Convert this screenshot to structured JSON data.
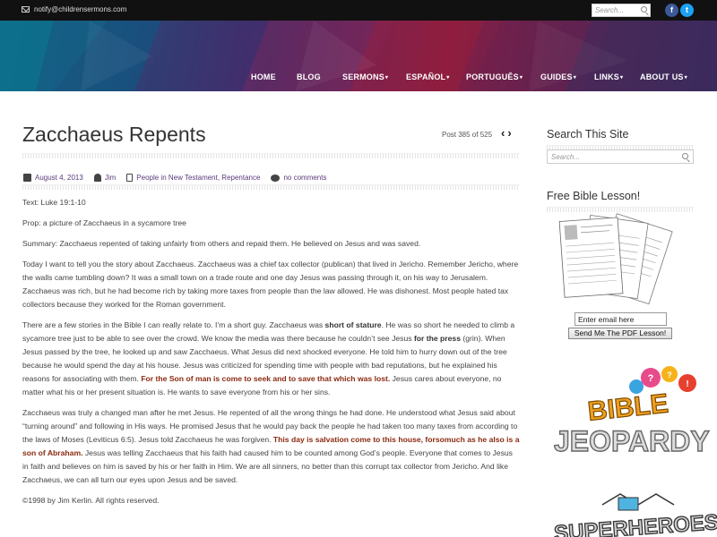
{
  "topbar": {
    "email": "notify@childrensermons.com",
    "search_placeholder": "Search...",
    "facebook": "f",
    "twitter": "t"
  },
  "nav": {
    "items": [
      {
        "label": "HOME",
        "dropdown": false
      },
      {
        "label": "BLOG",
        "dropdown": false
      },
      {
        "label": "SERMONS",
        "dropdown": true
      },
      {
        "label": "ESPAÑOL",
        "dropdown": true
      },
      {
        "label": "PORTUGUÊS",
        "dropdown": true
      },
      {
        "label": "GUIDES",
        "dropdown": true
      },
      {
        "label": "LINKS",
        "dropdown": true
      },
      {
        "label": "ABOUT US",
        "dropdown": true
      }
    ],
    "caret": "▾"
  },
  "post": {
    "title": "Zacchaeus Repents",
    "counter": "Post 385 of 525",
    "prev": "‹",
    "next": "›",
    "date": "August 4, 2013",
    "author": "Jim",
    "categories": "People in New Testament, Repentance",
    "comments": "no comments",
    "text": "Text: Luke 19:1-10",
    "prop": "Prop: a picture of Zacchaeus in a sycamore tree",
    "summary": "Summary: Zacchaeus repented of taking unfairly from others and repaid them. He believed on Jesus and was saved.",
    "p1": "Today I want to tell you the story about Zacchaeus. Zacchaeus was a chief tax collector (publican) that lived in Jericho. Remember Jericho, where the walls came tumbling down? It was a small town on a trade route and one day Jesus was passing through it, on his way to Jerusalem. Zacchaeus was rich, but he had become rich by taking more taxes from people than the law allowed. He was dishonest. Most people hated tax collectors because they worked for the Roman government.",
    "p2a": "There are a few stories in the Bible I can really relate to. I’m a short guy. Zacchaeus was ",
    "p2b": "short of stature",
    "p2c": ". He was so short he needed to climb a sycamore tree just to be able to see over the crowd. We know the media was there because he couldn’t see Jesus ",
    "p2d": "for the press",
    "p2e": " (grin). When Jesus passed by the tree, he looked up and saw Zacchaeus. What Jesus did next shocked everyone. He told him to hurry down out of the tree because he would spend the day at his house. Jesus was criticized for spending time with people with bad reputations, but he explained his reasons for associating with them. ",
    "p2f": "For the Son of man is come to seek and to save that which was lost.",
    "p2g": " Jesus cares about everyone, no matter what his or her present situation is. He wants to save everyone from his or her sins.",
    "p3a": "Zacchaeus was truly a changed man after he met Jesus. He repented of all the wrong things he had done. He understood what Jesus said about “turning around” and following in His ways. He promised Jesus that he would pay back the people he had taken too many taxes from according to the laws of Moses (Leviticus 6:5). Jesus told Zacchaeus he was forgiven. ",
    "p3b": "This day is salvation come to this house, forsomuch as he also is a son of Abraham.",
    "p3c": " Jesus was telling Zacchaeus that his faith had caused him to be counted among God’s people. Everyone that comes to Jesus in faith and believes on him is saved by his or her faith in Him. We are all sinners, no better than this corrupt tax collector from Jericho. And like Zacchaeus, we can all turn our eyes upon Jesus and be saved.",
    "copyright": "©1998 by Jim Kerlin. All rights reserved."
  },
  "sidebar": {
    "search_heading": "Search This Site",
    "search_placeholder": "Search...",
    "lesson_heading": "Free Bible Lesson!",
    "email_value": "Enter email here",
    "send_label": "Send Me The PDF Lesson!",
    "jeopardy_top": "BIBLE",
    "jeopardy_bottom": "JEOPARDY",
    "superheroes": "SUPERHEROES"
  }
}
